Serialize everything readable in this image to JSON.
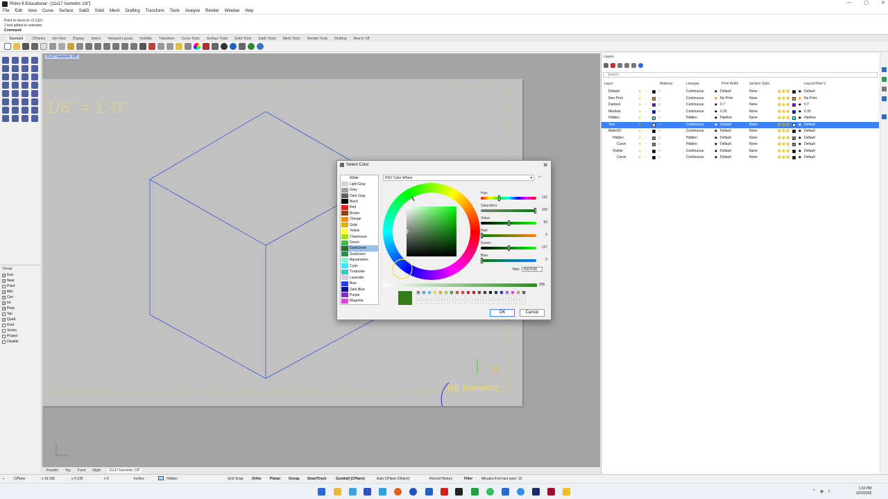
{
  "window": {
    "title": "Rhino 8 Educational - [11x17 Isometric 1/8\"]",
    "controls": [
      "—",
      "▢",
      "✕"
    ]
  },
  "menu": [
    "File",
    "Edit",
    "View",
    "Curve",
    "Surface",
    "SubD",
    "Solid",
    "Mesh",
    "Drafting",
    "Transform",
    "Tools",
    "Analyze",
    "Render",
    "Window",
    "Help"
  ],
  "command_history": {
    "line2": "Point to move to <2.132>",
    "line3": "1 text added to selection.",
    "prompt": "Command:"
  },
  "toolbar_tabs": [
    "Standard",
    "CPlanes",
    "Set View",
    "Display",
    "Select",
    "Viewport Layout",
    "Visibility",
    "Transform",
    "Curve Tools",
    "Surface Tools",
    "Solid Tools",
    "SubD Tools",
    "Mesh Tools",
    "Render Tools",
    "Drafting",
    "New in V8"
  ],
  "viewport": {
    "title": "11x17 Isometric 1/8\"",
    "scale_text": "1/8\" = 1'-0\"",
    "detail_label": "NE Isometric"
  },
  "osnap": {
    "header": "Osnap",
    "items": [
      {
        "label": "End",
        "checked": true
      },
      {
        "label": "Near",
        "checked": true
      },
      {
        "label": "Point",
        "checked": false
      },
      {
        "label": "Mid",
        "checked": true
      },
      {
        "label": "Cen",
        "checked": true
      },
      {
        "label": "Int",
        "checked": true
      },
      {
        "label": "Perp",
        "checked": true
      },
      {
        "label": "Tan",
        "checked": false
      },
      {
        "label": "Quad",
        "checked": true
      },
      {
        "label": "Knot",
        "checked": false
      },
      {
        "label": "Vertex",
        "checked": false
      },
      {
        "label": "Project",
        "checked": false
      },
      {
        "label": "Disable",
        "checked": false
      }
    ]
  },
  "layout_tabs": [
    "Parallel",
    "Top",
    "Front",
    "Right",
    "11x17 Isometric 1/8\""
  ],
  "status": {
    "cplane": "CPlane",
    "x": "x 19.166",
    "y": "y 4.130",
    "z": "z 0",
    "units": "Inches",
    "layer": "Hidden",
    "grid_snap": "Grid Snap",
    "ortho": "Ortho",
    "planar": "Planar",
    "osnap": "Osnap",
    "smarttrack": "SmartTrack",
    "gumball": "Gumball (CPlane)",
    "auto_cplane": "Auto CPlane (Object)",
    "record_history": "Record History",
    "filter": "Filter",
    "minutes": "Minutes from last save: 16"
  },
  "layers": {
    "panel_title": "Layers",
    "search_placeholder": "Search",
    "columns": [
      "Layer",
      "Material",
      "Linetype",
      "Print Width",
      "Section Style",
      "Layout Print V"
    ],
    "rows": [
      {
        "name": "Default",
        "linetype": "Continuous",
        "print_width": "Default",
        "section": "None",
        "layout": "Default",
        "color": "#000000",
        "pw_color": "#000000",
        "selected": false
      },
      {
        "name": "Non Print",
        "linetype": "Continuous",
        "print_width": "No Print",
        "section": "None",
        "layout": "No Print",
        "color": "#ff8c00",
        "pw_color": "#ff8c00",
        "selected": false
      },
      {
        "name": "Darkest",
        "linetype": "Continuous",
        "print_width": "0.7",
        "section": "None",
        "layout": "0.7",
        "color": "#7f00ff",
        "pw_color": "#000000",
        "selected": false
      },
      {
        "name": "Medium",
        "linetype": "Continuous",
        "print_width": "0.35",
        "section": "None",
        "layout": "0.35",
        "color": "#0000ff",
        "pw_color": "#000000",
        "selected": false
      },
      {
        "name": "Hidden",
        "linetype": "Hidden",
        "print_width": "Hairline",
        "section": "None",
        "layout": "Hairline",
        "color": "#00ffff",
        "pw_color": "#000000",
        "selected": false
      },
      {
        "name": "Text",
        "linetype": "Continuous",
        "print_width": "Default",
        "section": "None",
        "layout": "Default",
        "color": "#ffffff",
        "pw_color": "#ffffff",
        "selected": true
      },
      {
        "name": "Make2D",
        "linetype": "Continuous",
        "print_width": "Default",
        "section": "None",
        "layout": "Default",
        "color": "#000000",
        "pw_color": "#000000",
        "selected": false
      },
      {
        "name": "Hidden",
        "linetype": "Hidden",
        "print_width": "Default",
        "section": "None",
        "layout": "Default",
        "color": "#808080",
        "pw_color": "#000000",
        "selected": false
      },
      {
        "name": "Curve",
        "linetype": "Hidden",
        "print_width": "Default",
        "section": "None",
        "layout": "Default",
        "color": "#808080",
        "pw_color": "#000000",
        "selected": false
      },
      {
        "name": "Visible",
        "linetype": "Continuous",
        "print_width": "Default",
        "section": "None",
        "layout": "Default",
        "color": "#000000",
        "pw_color": "#000000",
        "selected": false
      },
      {
        "name": "Curve",
        "linetype": "Continuous",
        "print_width": "Default",
        "section": "None",
        "layout": "Default",
        "color": "#000000",
        "pw_color": "#000000",
        "selected": false
      }
    ]
  },
  "dialog": {
    "title": "Select Color",
    "mode": "HSV Color Wheel",
    "colors": [
      {
        "name": "White",
        "hex": "#ffffff"
      },
      {
        "name": "Light Gray",
        "hex": "#d3d3d3"
      },
      {
        "name": "Gray",
        "hex": "#a0a0a0"
      },
      {
        "name": "Dark Gray",
        "hex": "#606060"
      },
      {
        "name": "Black",
        "hex": "#000000"
      },
      {
        "name": "Red",
        "hex": "#e02020"
      },
      {
        "name": "Brown",
        "hex": "#8b4513"
      },
      {
        "name": "Orange",
        "hex": "#ff8c00"
      },
      {
        "name": "Gold",
        "hex": "#e0b000"
      },
      {
        "name": "Yellow",
        "hex": "#ffff40"
      },
      {
        "name": "Chartreuse",
        "hex": "#a0e020"
      },
      {
        "name": "Green",
        "hex": "#40c040"
      },
      {
        "name": "DarkGreen",
        "hex": "#2f6f1a"
      },
      {
        "name": "SeaGreen",
        "hex": "#2e8b57"
      },
      {
        "name": "Aquamarine",
        "hex": "#7fffd4"
      },
      {
        "name": "Cyan",
        "hex": "#40e0ff"
      },
      {
        "name": "Turquoise",
        "hex": "#30c8c0"
      },
      {
        "name": "Lavender",
        "hex": "#d8c8f0"
      },
      {
        "name": "Blue",
        "hex": "#2040e0"
      },
      {
        "name": "Dark Blue",
        "hex": "#101090"
      },
      {
        "name": "Purple",
        "hex": "#8030c0"
      },
      {
        "name": "Magenta",
        "hex": "#e040e0"
      }
    ],
    "selected_color": "DarkGreen",
    "hue": {
      "label": "Hue:",
      "value": "120",
      "fraction": 0.33
    },
    "saturation": {
      "label": "Saturation:",
      "value": "100",
      "fraction": 1.0
    },
    "value": {
      "label": "Value:",
      "value": "50",
      "fraction": 0.5
    },
    "red": {
      "label": "Red:",
      "value": "0",
      "fraction": 0.0
    },
    "green": {
      "label": "Green:",
      "value": "127",
      "fraction": 0.5
    },
    "blue": {
      "label": "Blue:",
      "value": "0",
      "fraction": 0.0
    },
    "hex_label": "Hex:",
    "hex_value": "#007F00",
    "alpha": "255",
    "preview_color": "#367c1b",
    "ok": "OK",
    "cancel": "Cancel"
  },
  "clock": {
    "time": "1:32 PM",
    "date": "2/22/2026"
  }
}
